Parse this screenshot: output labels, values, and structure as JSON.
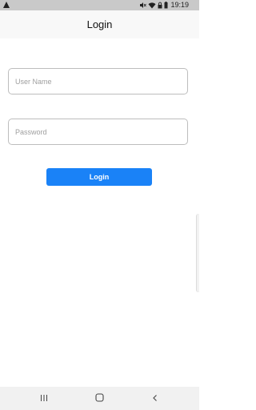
{
  "status_bar": {
    "time": "19:19",
    "icons": [
      "warning-icon",
      "mute-icon",
      "wifi-icon",
      "lock-icon",
      "battery-icon"
    ]
  },
  "header": {
    "title": "Login"
  },
  "form": {
    "username": {
      "placeholder": "User Name",
      "value": ""
    },
    "password": {
      "placeholder": "Password",
      "value": ""
    },
    "login_label": "Login"
  },
  "colors": {
    "accent": "#1a82f7",
    "status_bar": "#c9c9c9",
    "app_bar": "#f8f8f8",
    "nav_bar": "#f1f1f1"
  },
  "nav_bar": {
    "icons": [
      "recent-apps-icon",
      "home-icon",
      "back-icon"
    ]
  }
}
